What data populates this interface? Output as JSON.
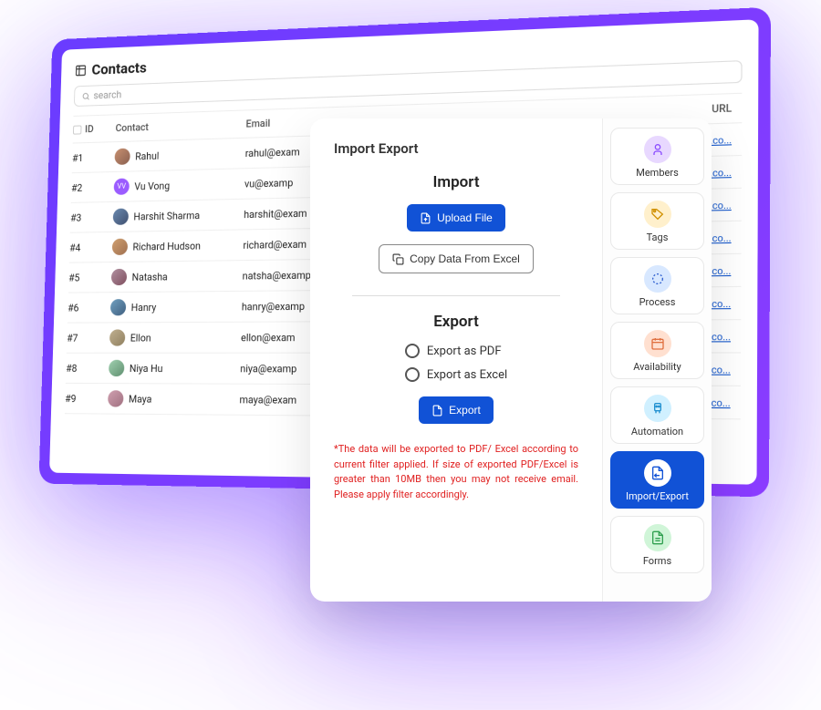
{
  "contacts": {
    "title": "Contacts",
    "search_placeholder": "search",
    "columns": {
      "id": "ID",
      "contact": "Contact",
      "email": "Email",
      "url": "URL"
    },
    "rows": [
      {
        "id": "#1",
        "name": "Rahul",
        "email": "rahul@exam",
        "url": "nnel.co..."
      },
      {
        "id": "#2",
        "name": "Vu Vong",
        "email": "vu@examp",
        "url": "nnel.co..."
      },
      {
        "id": "#3",
        "name": "Harshit Sharma",
        "email": "harshit@exam",
        "url": "nnel.co..."
      },
      {
        "id": "#4",
        "name": "Richard Hudson",
        "email": "richard@exam",
        "url": "nnel.co..."
      },
      {
        "id": "#5",
        "name": "Natasha",
        "email": "natsha@examp",
        "url": "nnel.co..."
      },
      {
        "id": "#6",
        "name": "Hanry",
        "email": "hanry@examp",
        "url": "nnel.co..."
      },
      {
        "id": "#7",
        "name": "Ellon",
        "email": "ellon@exam",
        "url": "nnel.co..."
      },
      {
        "id": "#8",
        "name": "Niya Hu",
        "email": "niya@examp",
        "url": "nnel.co..."
      },
      {
        "id": "#9",
        "name": "Maya",
        "email": "maya@exam",
        "url": "nnel.co..."
      }
    ]
  },
  "modal": {
    "title": "Import Export",
    "import": {
      "heading": "Import",
      "upload_label": "Upload File",
      "copy_label": "Copy Data From Excel"
    },
    "export": {
      "heading": "Export",
      "option_pdf": "Export as PDF",
      "option_excel": "Export as Excel",
      "button_label": "Export"
    },
    "disclaimer": "*The data will be exported to PDF/ Excel according to current filter applied. If size of exported PDF/Excel is greater than 10MB then you may not receive email. Please apply filter accordingly."
  },
  "sidebar": {
    "items": [
      {
        "label": "Members",
        "icon": "members-icon",
        "color": "purple"
      },
      {
        "label": "Tags",
        "icon": "tags-icon",
        "color": "yellow"
      },
      {
        "label": "Process",
        "icon": "process-icon",
        "color": "blue"
      },
      {
        "label": "Availability",
        "icon": "availability-icon",
        "color": "orange"
      },
      {
        "label": "Automation",
        "icon": "automation-icon",
        "color": "cyan"
      },
      {
        "label": "Import/Export",
        "icon": "import-export-icon",
        "color": "white",
        "active": true
      },
      {
        "label": "Forms",
        "icon": "forms-icon",
        "color": "green"
      }
    ]
  }
}
